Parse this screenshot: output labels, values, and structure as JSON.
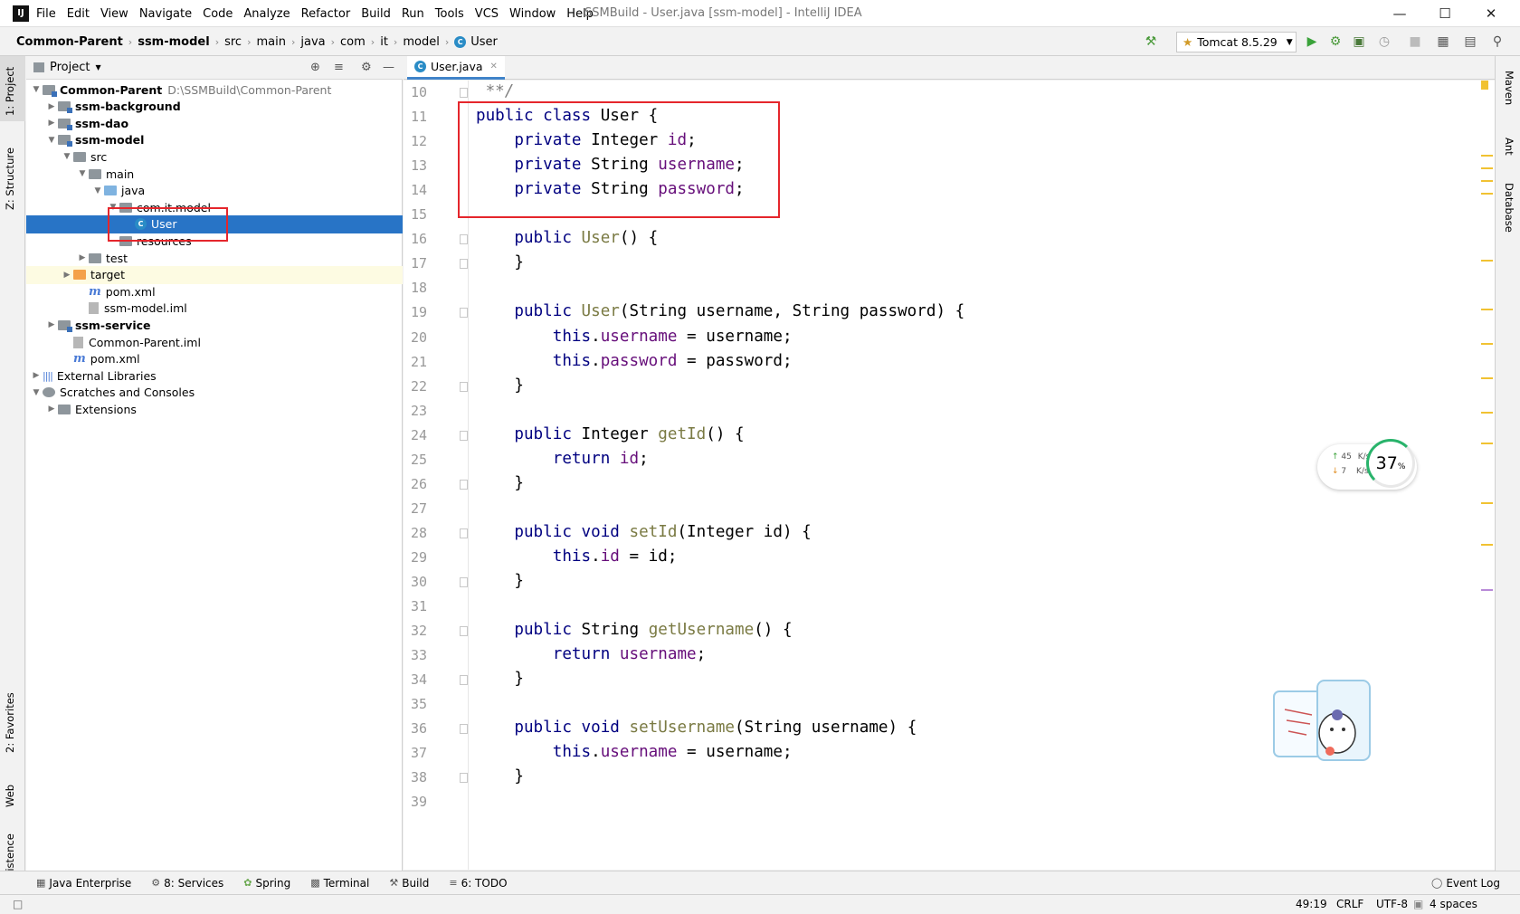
{
  "app": {
    "logo": "IJ",
    "title": "SSMBuild - User.java [ssm-model] - IntelliJ IDEA"
  },
  "menu": [
    "File",
    "Edit",
    "View",
    "Navigate",
    "Code",
    "Analyze",
    "Refactor",
    "Build",
    "Run",
    "Tools",
    "VCS",
    "Window",
    "Help"
  ],
  "breadcrumb": [
    "Common-Parent",
    "ssm-model",
    "src",
    "main",
    "java",
    "com",
    "it",
    "model",
    "User"
  ],
  "run_config": "Tomcat 8.5.29",
  "left_tabs": {
    "project": "1: Project",
    "structure": "Z: Structure",
    "favorites": "2: Favorites",
    "web": "Web",
    "persistence": "Persistence"
  },
  "right_tabs": {
    "maven": "Maven",
    "ant": "Ant",
    "database": "Database"
  },
  "project_panel": {
    "title": "Project"
  },
  "tree": [
    {
      "label": "Common-Parent",
      "extra": "D:\\SSMBuild\\Common-Parent",
      "bold": true
    },
    {
      "label": "ssm-background",
      "bold": true
    },
    {
      "label": "ssm-dao",
      "bold": true
    },
    {
      "label": "ssm-model",
      "bold": true
    },
    {
      "label": "src"
    },
    {
      "label": "main"
    },
    {
      "label": "java"
    },
    {
      "label": "com.it.model"
    },
    {
      "label": "User"
    },
    {
      "label": "resources"
    },
    {
      "label": "test"
    },
    {
      "label": "target"
    },
    {
      "label": "pom.xml"
    },
    {
      "label": "ssm-model.iml"
    },
    {
      "label": "ssm-service",
      "bold": true
    },
    {
      "label": "Common-Parent.iml"
    },
    {
      "label": "pom.xml"
    },
    {
      "label": "External Libraries"
    },
    {
      "label": "Scratches and Consoles"
    },
    {
      "label": "Extensions"
    }
  ],
  "editor_tab": "User.java",
  "line_numbers": [
    "10",
    "11",
    "12",
    "13",
    "14",
    "15",
    "16",
    "17",
    "18",
    "19",
    "20",
    "21",
    "22",
    "23",
    "24",
    "25",
    "26",
    "27",
    "28",
    "29",
    "30",
    "31",
    "32",
    "33",
    "34",
    "35",
    "36",
    "37",
    "38",
    "39"
  ],
  "code_lines": [
    " **/",
    "public class User {",
    "    private Integer id;",
    "    private String username;",
    "    private String password;",
    "",
    "    public User() {",
    "    }",
    "",
    "    public User(String username, String password) {",
    "        this.username = username;",
    "        this.password = password;",
    "    }",
    "",
    "    public Integer getId() {",
    "        return id;",
    "    }",
    "",
    "    public void setId(Integer id) {",
    "        this.id = id;",
    "    }",
    "",
    "    public String getUsername() {",
    "        return username;",
    "    }",
    "",
    "    public void setUsername(String username) {",
    "        this.username = username;",
    "    }",
    ""
  ],
  "net_widget": {
    "up": "45",
    "down": "7",
    "unit": "K/s",
    "percent": "37",
    "percent_unit": "%"
  },
  "bottom_tools": [
    "Java Enterprise",
    "8: Services",
    "Spring",
    "Terminal",
    "Build",
    "6: TODO"
  ],
  "event_log": "Event Log",
  "status": {
    "position": "49:19",
    "line_sep": "CRLF",
    "encoding": "UTF-8",
    "indent": "4 spaces"
  },
  "colors": {
    "selection": "#2874c6",
    "highlight_box": "#e5262c",
    "keyword": "#000080",
    "field": "#660e7a"
  }
}
